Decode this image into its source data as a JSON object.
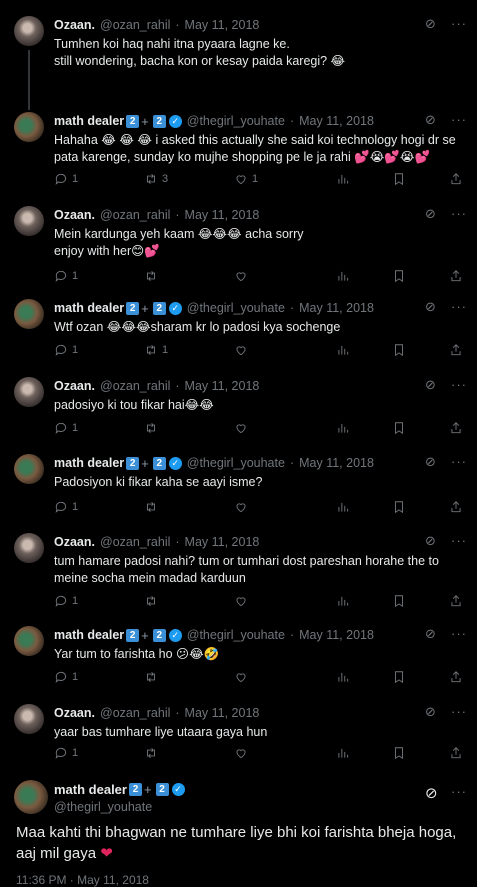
{
  "ozan": {
    "name": "Ozaan.",
    "handle": "@ozan_rahil",
    "date": "May 11, 2018"
  },
  "math": {
    "name": "math dealer",
    "badge1": "2",
    "badge2": "2",
    "handle": "@thegirl_youhate",
    "date": "May 11, 2018"
  },
  "tweets": [
    {
      "author": "ozan",
      "text": "Tumhen koi haq nahi itna pyaara lagne ke.\nstill wondering, bacha kon or kesay paida karegi? 😂"
    },
    {
      "author": "math",
      "text": "Hahaha 😂 😂 😂 i asked this actually she said koi technology hogi dr se pata karenge, sunday ko mujhe shopping pe le ja rahi 💕😭💕😭💕",
      "reply": "1",
      "retweet": "3",
      "like": "1"
    },
    {
      "author": "ozan",
      "text": "Mein kardunga yeh kaam 😂😂😂 acha sorry\nenjoy with her😊💕",
      "reply": "1",
      "retweet": "",
      "like": ""
    },
    {
      "author": "math",
      "text": "Wtf ozan 😂😂😂sharam kr lo padosi kya sochenge",
      "reply": "1",
      "retweet": "1",
      "like": ""
    },
    {
      "author": "ozan",
      "text": "padosiyo ki tou fikar hai😂😂",
      "reply": "1",
      "retweet": "",
      "like": ""
    },
    {
      "author": "math",
      "text": "Padosiyon ki fikar kaha se aayi isme?",
      "reply": "1",
      "retweet": "",
      "like": ""
    },
    {
      "author": "ozan",
      "text": "tum hamare padosi nahi? tum or tumhari dost pareshan horahe the to meine socha mein madad karduun",
      "reply": "1",
      "retweet": "",
      "like": ""
    },
    {
      "author": "math",
      "text": "Yar tum to farishta ho 😕😂🤣",
      "reply": "1",
      "retweet": "",
      "like": ""
    },
    {
      "author": "ozan",
      "text": "yaar bas tumhare liye utaara gaya hun",
      "reply": "1",
      "retweet": "",
      "like": ""
    }
  ],
  "main": {
    "name": "math dealer",
    "badge1": "2",
    "badge2": "2",
    "handle": "@thegirl_youhate",
    "text": "Maa kahti thi bhagwan ne tumhare liye bhi koi farishta bheja hoga, aaj mil gaya",
    "heart": "❤",
    "timestamp": "11:36 PM · May 11, 2018"
  },
  "icons": {
    "more": "···",
    "grok": "⊘"
  }
}
